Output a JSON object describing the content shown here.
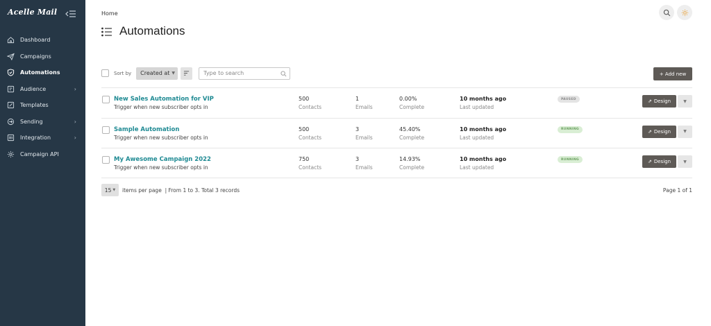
{
  "sidebar": {
    "logo": "Acelle Mail",
    "items": [
      {
        "label": "Dashboard",
        "icon": "home-icon",
        "active": false,
        "chevron": false
      },
      {
        "label": "Campaigns",
        "icon": "send-icon",
        "active": false,
        "chevron": false
      },
      {
        "label": "Automations",
        "icon": "shield-check-icon",
        "active": true,
        "chevron": false
      },
      {
        "label": "Audience",
        "icon": "audience-icon",
        "active": false,
        "chevron": true
      },
      {
        "label": "Templates",
        "icon": "edit-icon",
        "active": false,
        "chevron": false
      },
      {
        "label": "Sending",
        "icon": "sending-icon",
        "active": false,
        "chevron": true
      },
      {
        "label": "Integration",
        "icon": "integration-icon",
        "active": false,
        "chevron": true
      },
      {
        "label": "Campaign API",
        "icon": "gear-icon",
        "active": false,
        "chevron": false
      }
    ]
  },
  "header": {
    "breadcrumb": "Home",
    "title": "Automations"
  },
  "toolbar": {
    "sort_label": "Sort by",
    "sort_value": "Created at",
    "search_placeholder": "Type to search",
    "add_new_label": "+ Add new"
  },
  "rows": [
    {
      "name": "New Sales Automation for VIP",
      "trigger": "Trigger when new subscriber opts in",
      "contacts": "500",
      "contacts_label": "Contacts",
      "emails": "1",
      "emails_label": "Emails",
      "complete": "0.00%",
      "complete_label": "Complete",
      "updated": "10 months ago",
      "updated_label": "Last updated",
      "status": "PAUSED",
      "design_label": "Design"
    },
    {
      "name": "Sample Automation",
      "trigger": "Trigger when new subscriber opts in",
      "contacts": "500",
      "contacts_label": "Contacts",
      "emails": "3",
      "emails_label": "Emails",
      "complete": "45.40%",
      "complete_label": "Complete",
      "updated": "10 months ago",
      "updated_label": "Last updated",
      "status": "RUNNING",
      "design_label": "Design"
    },
    {
      "name": "My Awesome Campaign 2022",
      "trigger": "Trigger when new subscriber opts in",
      "contacts": "750",
      "contacts_label": "Contacts",
      "emails": "3",
      "emails_label": "Emails",
      "complete": "14.93%",
      "complete_label": "Complete",
      "updated": "10 months ago",
      "updated_label": "Last updated",
      "status": "RUNNING",
      "design_label": "Design"
    }
  ],
  "pagination": {
    "per_page": "15",
    "summary": "items per page  | From 1 to 3. Total 3 records",
    "page_info": "Page 1 of 1"
  },
  "colors": {
    "sidebar_bg": "#263746",
    "link": "#1f8a93",
    "button_dark": "#5e5a56",
    "running_bg": "#d9eed4",
    "paused_bg": "#e4e4e4"
  }
}
